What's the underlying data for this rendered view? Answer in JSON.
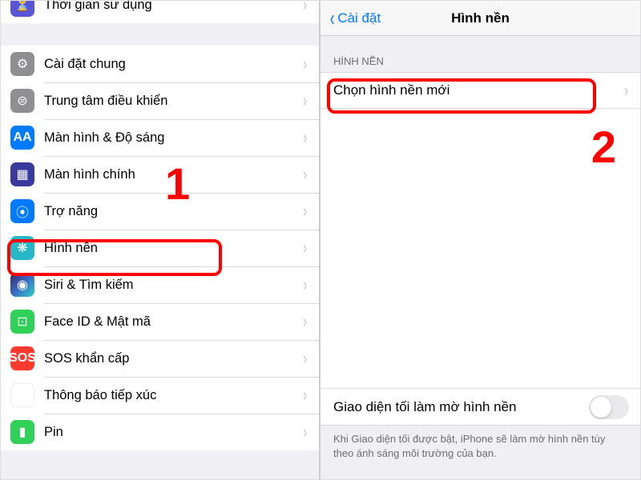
{
  "left": {
    "rows": [
      {
        "icon": "hourglass-icon",
        "cls": "ic-hourglass",
        "glyph": "⏳",
        "label": "Thời gian sử dụng"
      },
      {
        "gap": true
      },
      {
        "icon": "gear-icon",
        "cls": "ic-gear",
        "glyph": "⚙",
        "label": "Cài đặt chung"
      },
      {
        "icon": "control-center-icon",
        "cls": "ic-control",
        "glyph": "⊜",
        "label": "Trung tâm điều khiển"
      },
      {
        "icon": "display-icon",
        "cls": "ic-display",
        "glyph": "AA",
        "label": "Màn hình & Độ sáng"
      },
      {
        "icon": "home-icon",
        "cls": "ic-home",
        "glyph": "▦",
        "label": "Màn hình chính"
      },
      {
        "icon": "accessibility-icon",
        "cls": "ic-access",
        "glyph": "⦿",
        "label": "Trợ năng"
      },
      {
        "icon": "wallpaper-icon",
        "cls": "ic-wallpaper",
        "glyph": "❋",
        "label": "Hình nền"
      },
      {
        "icon": "siri-icon",
        "cls": "ic-siri",
        "glyph": "◉",
        "label": "Siri & Tìm kiếm"
      },
      {
        "icon": "faceid-icon",
        "cls": "ic-faceid",
        "glyph": "⊡",
        "label": "Face ID & Mật mã"
      },
      {
        "icon": "sos-icon",
        "cls": "ic-sos",
        "glyph": "SOS",
        "label": "SOS khẩn cấp"
      },
      {
        "icon": "exposure-icon",
        "cls": "ic-exposure",
        "glyph": "✴",
        "label": "Thông báo tiếp xúc"
      },
      {
        "icon": "battery-icon",
        "cls": "ic-battery",
        "glyph": "▮",
        "label": "Pin"
      }
    ]
  },
  "right": {
    "back_label": "Cài đặt",
    "title": "Hình nền",
    "section": "HÌNH NỀN",
    "choose": "Chọn hình nền mới",
    "toggle_label": "Giao diện tối làm mờ hình nền",
    "toggle_on": false,
    "footer": "Khi Giao diện tối được bật, iPhone sẽ làm mờ hình nền tùy theo ánh sáng môi trường của bạn."
  },
  "annotations": {
    "num1": "1",
    "num2": "2"
  }
}
